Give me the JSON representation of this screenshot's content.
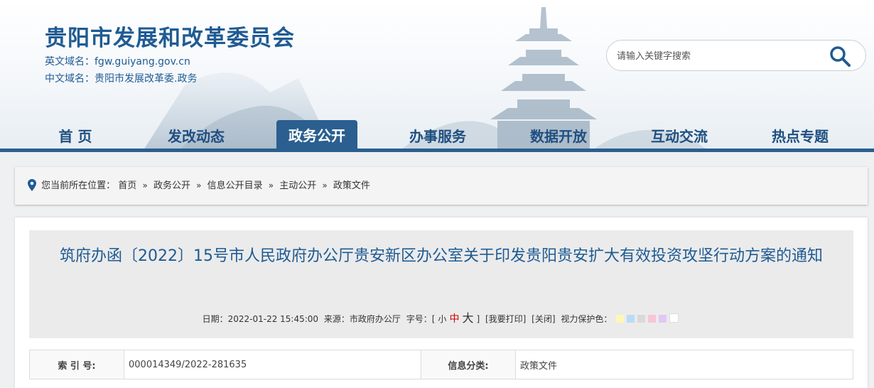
{
  "header": {
    "site_title": "贵阳市发展和改革委员会",
    "english_domain": "英文域名：fgw.guiyang.gov.cn",
    "chinese_domain": "中文域名：贵阳市发展改革委.政务"
  },
  "search": {
    "placeholder": "请输入关键字搜索",
    "icon": "search-icon"
  },
  "nav": {
    "items": [
      {
        "label": "首 页"
      },
      {
        "label": "发改动态"
      },
      {
        "label": "政务公开",
        "active": true
      },
      {
        "label": "办事服务"
      },
      {
        "label": "数据开放"
      },
      {
        "label": "互动交流"
      },
      {
        "label": "热点专题"
      }
    ]
  },
  "breadcrumb": {
    "prefix": "您当前所在位置：",
    "items": [
      "首页",
      "政务公开",
      "信息公开目录",
      "主动公开",
      "政策文件"
    ],
    "separator": "»"
  },
  "article": {
    "title": "筑府办函〔2022〕15号市人民政府办公厅贵安新区办公室关于印发贵阳贵安扩大有效投资攻坚行动方案的通知",
    "date": "日期：2022-01-22 15:45:00",
    "source": "来源：市政府办公厅",
    "font_size_label": "字号：[",
    "font_small": "小",
    "font_mid": "中",
    "font_big": "大",
    "font_size_close": "]",
    "print": "[我要打印]",
    "close": "[关闭]",
    "eye_care_label": "视力保护色：",
    "eye_care_colors": [
      "#fdf7b8",
      "#b8dcf5",
      "#d9d9d9",
      "#f5c6d4",
      "#e0c8f5",
      "#ffffff"
    ]
  },
  "info_table": {
    "index_label": "索 引 号:",
    "index_value": "000014349/2022-281635",
    "category_label": "信息分类:",
    "category_value": "政策文件"
  },
  "colors": {
    "brand": "#1f5b93",
    "nav_bar": "#2a5f8f",
    "font_mid_highlight": "#cc0000"
  }
}
